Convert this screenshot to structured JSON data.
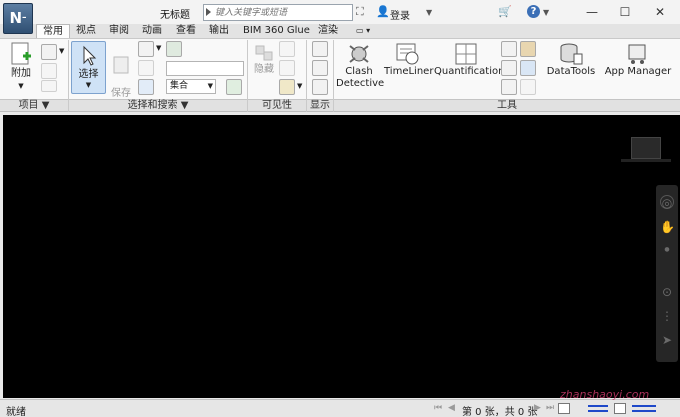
{
  "window": {
    "title": "无标题",
    "app_logo": "N",
    "search_placeholder": "键入关键字或短语",
    "login_label": "登录",
    "help_label": "?",
    "controls": {
      "minimize": "—",
      "maximize": "☐",
      "close": "✕"
    }
  },
  "tabs": [
    {
      "label": "常用",
      "active": true
    },
    {
      "label": "视点"
    },
    {
      "label": "审阅"
    },
    {
      "label": "动画"
    },
    {
      "label": "查看"
    },
    {
      "label": "输出"
    },
    {
      "label": "BIM 360 Glue"
    },
    {
      "label": "渲染"
    }
  ],
  "ribbon": {
    "append_label": "附加",
    "select_label": "选择",
    "save_selection_label": "保存\n选择",
    "set_combo_label": "集合",
    "hide_label": "隐藏",
    "clash_label_1": "Clash",
    "clash_label_2": "Detective",
    "timeliner_label": "TimeLiner",
    "quantification_label": "Quantification",
    "datatools_label": "DataTools",
    "appmanager_label": "App Manager",
    "panels": {
      "project": "项目 ▼",
      "select_search": "选择和搜索 ▼",
      "visibility": "可见性",
      "display": "显示",
      "tools": "工具"
    }
  },
  "status": {
    "left": "就绪",
    "page_info": "第 0 张，共 0 张"
  },
  "watermark": "zhanshaoyi.com",
  "colors": {
    "viewport": "#000000",
    "select_active": "#cfe2f6"
  }
}
